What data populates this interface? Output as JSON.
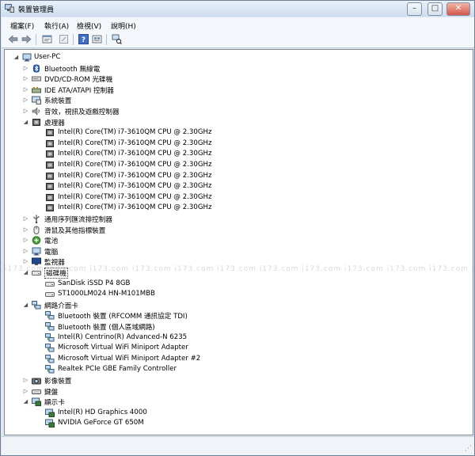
{
  "window": {
    "title": "裝置管理員",
    "controls": {
      "minimize": "–",
      "maximize": "□",
      "close": "✕"
    }
  },
  "menu": [
    "檔案(F)",
    "執行(A)",
    "檢視(V)",
    "說明(H)"
  ],
  "toolbar": {
    "buttons": [
      "back-arrow-icon",
      "forward-arrow-icon",
      "properties-icon",
      "update-driver-icon",
      "help-icon",
      "show-hidden-icon",
      "scan-hardware-icon"
    ]
  },
  "tree": {
    "root": "User-PC",
    "categories": [
      {
        "label": "Bluetooth 無線電",
        "icon": "bluetooth-icon",
        "expanded": false
      },
      {
        "label": "DVD/CD-ROM 光碟機",
        "icon": "dvd-drive-icon",
        "expanded": false
      },
      {
        "label": "IDE ATA/ATAPI 控制器",
        "icon": "ide-controller-icon",
        "expanded": false
      },
      {
        "label": "系統裝置",
        "icon": "system-device-icon",
        "expanded": false
      },
      {
        "label": "音效，視訊及遊戲控制器",
        "icon": "sound-icon",
        "expanded": false
      },
      {
        "label": "處理器",
        "icon": "processor-icon",
        "expanded": true,
        "children": [
          "Intel(R) Core(TM) i7-3610QM CPU @ 2.30GHz",
          "Intel(R) Core(TM) i7-3610QM CPU @ 2.30GHz",
          "Intel(R) Core(TM) i7-3610QM CPU @ 2.30GHz",
          "Intel(R) Core(TM) i7-3610QM CPU @ 2.30GHz",
          "Intel(R) Core(TM) i7-3610QM CPU @ 2.30GHz",
          "Intel(R) Core(TM) i7-3610QM CPU @ 2.30GHz",
          "Intel(R) Core(TM) i7-3610QM CPU @ 2.30GHz",
          "Intel(R) Core(TM) i7-3610QM CPU @ 2.30GHz"
        ]
      },
      {
        "label": "通用序列匯流排控制器",
        "icon": "usb-icon",
        "expanded": false
      },
      {
        "label": "滑鼠及其他指標裝置",
        "icon": "mouse-icon",
        "expanded": false
      },
      {
        "label": "電池",
        "icon": "battery-icon",
        "expanded": false
      },
      {
        "label": "電腦",
        "icon": "computer-icon",
        "expanded": false
      },
      {
        "label": "監視器",
        "icon": "monitor-icon",
        "expanded": false
      },
      {
        "label": "磁碟機",
        "icon": "disk-drive-icon",
        "expanded": true,
        "selected": true,
        "children": [
          "SanDisk iSSD P4 8GB",
          "ST1000LM024 HN-M101MBB"
        ]
      },
      {
        "label": "網路介面卡",
        "icon": "network-adapter-icon",
        "expanded": true,
        "children": [
          "Bluetooth 裝置 (RFCOMM 通訊協定 TDI)",
          "Bluetooth 裝置 (個人區域網路)",
          "Intel(R) Centrino(R) Advanced-N 6235",
          "Microsoft Virtual WiFi Miniport Adapter",
          "Microsoft Virtual WiFi Miniport Adapter #2",
          "Realtek PCIe GBE Family Controller"
        ]
      },
      {
        "label": "影像裝置",
        "icon": "imaging-device-icon",
        "expanded": false
      },
      {
        "label": "鍵盤",
        "icon": "keyboard-icon",
        "expanded": false
      },
      {
        "label": "顯示卡",
        "icon": "display-adapter-icon",
        "expanded": true,
        "children": [
          "Intel(R) HD Graphics 4000",
          "NVIDIA GeForce GT 650M"
        ]
      }
    ]
  },
  "watermark": "i173.com",
  "colors": {
    "selection_border": "#333333",
    "tree_background": "#ffffff",
    "chrome": "#dfe9f5"
  }
}
